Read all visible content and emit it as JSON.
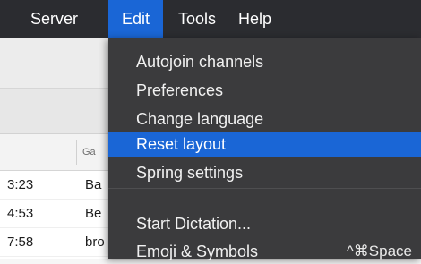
{
  "menubar": {
    "items": [
      {
        "label": "Server"
      },
      {
        "label": "Edit",
        "active": true
      },
      {
        "label": "Tools"
      },
      {
        "label": "Help"
      }
    ],
    "background": "#2b2c30",
    "accent": "#1a66d6"
  },
  "table": {
    "header": {
      "game_label": "Ga"
    },
    "rows": [
      {
        "time": "3:23",
        "game": "Ba"
      },
      {
        "time": "4:53",
        "game": "Be"
      },
      {
        "time": "7:58",
        "game": "bro"
      }
    ]
  },
  "edit_menu": {
    "items": [
      {
        "label": "Autojoin channels"
      },
      {
        "label": "Preferences"
      },
      {
        "label": "Change language"
      },
      {
        "label": "Reset layout",
        "highlighted": true
      },
      {
        "label": "Spring settings"
      },
      {
        "label": "Start Dictation..."
      },
      {
        "label": "Emoji & Symbols",
        "shortcut": "^⌘Space"
      }
    ]
  }
}
